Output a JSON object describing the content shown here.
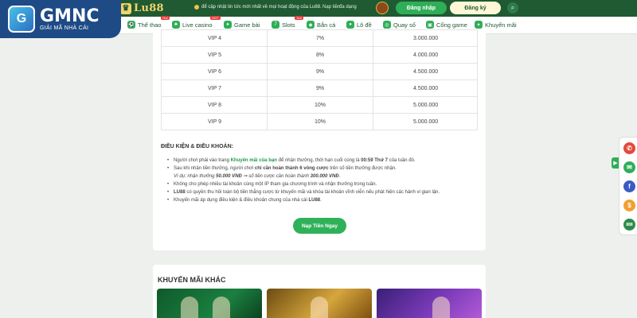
{
  "brand_overlay": {
    "main": "GMNC",
    "sub": "GIẢI MÃ NHÀ CÁI"
  },
  "header": {
    "logo_text": "Lu88",
    "marquee": "để cập nhật tin tức mới nhất về mọi hoạt động của Lu88.",
    "deposit_text": "Nạp tiền",
    "deposit_suffix": "đa dạng",
    "login_label": "Đăng nhập",
    "register_label": "Đăng ký"
  },
  "nav": {
    "items": [
      {
        "label": "Thể thao",
        "icon": "soccer-icon",
        "glyph": "⚽",
        "hot": "Hot"
      },
      {
        "label": "Live casino",
        "icon": "cards-icon",
        "glyph": "♣",
        "hot": "HOT"
      },
      {
        "label": "Game bài",
        "icon": "card-game-icon",
        "glyph": "♠",
        "hot": ""
      },
      {
        "label": "Slots",
        "icon": "slots-icon",
        "glyph": "7",
        "hot": "Hot"
      },
      {
        "label": "Bắn cá",
        "icon": "fish-icon",
        "glyph": "◆",
        "hot": ""
      },
      {
        "label": "Lô đề",
        "icon": "lottery-icon",
        "glyph": "●",
        "hot": ""
      },
      {
        "label": "Quay số",
        "icon": "wheel-icon",
        "glyph": "◎",
        "hot": ""
      },
      {
        "label": "Cổng game",
        "icon": "gamepad-icon",
        "glyph": "▣",
        "hot": ""
      },
      {
        "label": "Khuyến mãi",
        "icon": "gift-icon",
        "glyph": "✦",
        "hot": ""
      }
    ]
  },
  "vip_table": {
    "rows": [
      {
        "level": "VIP 4",
        "percent": "7%",
        "amount": "3.000.000"
      },
      {
        "level": "VIP 5",
        "percent": "8%",
        "amount": "4.000.000"
      },
      {
        "level": "VIP 6",
        "percent": "9%",
        "amount": "4.500.000"
      },
      {
        "level": "VIP 7",
        "percent": "9%",
        "amount": "4.500.000"
      },
      {
        "level": "VIP 8",
        "percent": "10%",
        "amount": "5.000.000"
      },
      {
        "level": "VIP 9",
        "percent": "10%",
        "amount": "5.000.000"
      }
    ]
  },
  "terms": {
    "title": "ĐIỀU KIỆN & ĐIỀU KHOẢN:",
    "t1_a": "Người chơi phải vào trang ",
    "t1_link": "Khuyến mãi của bạn",
    "t1_b": " để nhận thưởng, thời hạn cuối cùng là ",
    "t1_time": "00:59 Thứ 7",
    "t1_c": " của tuần đó.",
    "t2_a": "Sau khi nhận tiền thưởng, người chơi ",
    "t2_bold": "chỉ cần hoàn thành 6 vòng cược",
    "t2_b": " trên số tiền thưởng được nhận.",
    "t2_note_a": "Ví dụ: nhận thưởng ",
    "t2_note_b1": "50.000 VNĐ",
    "t2_note_mid": " ⇒ số tiền cược cần hoàn thành ",
    "t2_note_b2": "300.000 VNĐ",
    "t2_note_end": ".",
    "t3": "Không cho phép nhiều tài khoản cùng một IP tham gia chương trình và nhận thưởng trong tuần.",
    "t4_bold": "LU88",
    "t4": " có quyền thu hồi toàn bộ tiền thắng cược từ khuyến mãi và khóa tài khoản vĩnh viễn nếu phát hiện các hành vi gian lận.",
    "t5_a": "Khuyến mãi áp dụng điều kiện & điều khoản chung của nhà cái ",
    "t5_bold": "LU88",
    "t5_end": "."
  },
  "cta_label": "Nạp Tiền Ngay",
  "other_promos_title": "KHUYẾN MÃI KHÁC",
  "side_contacts": [
    {
      "icon": "phone-icon",
      "glyph": "✆",
      "color": "#e24a3b"
    },
    {
      "icon": "chat-icon",
      "glyph": "✉",
      "color": "#2fae58"
    },
    {
      "icon": "facebook-icon",
      "glyph": "f",
      "color": "#3b5bc4"
    },
    {
      "icon": "coin-icon",
      "glyph": "$",
      "color": "#f0a030"
    },
    {
      "icon": "lu88-badge-icon",
      "glyph": "888",
      "color": "#2a8c4a"
    }
  ],
  "colors": {
    "header_bg": "#1f5a33",
    "accent_green": "#2fae58",
    "gold": "#f2d36b",
    "overlay_blue": "#1e4b86"
  }
}
